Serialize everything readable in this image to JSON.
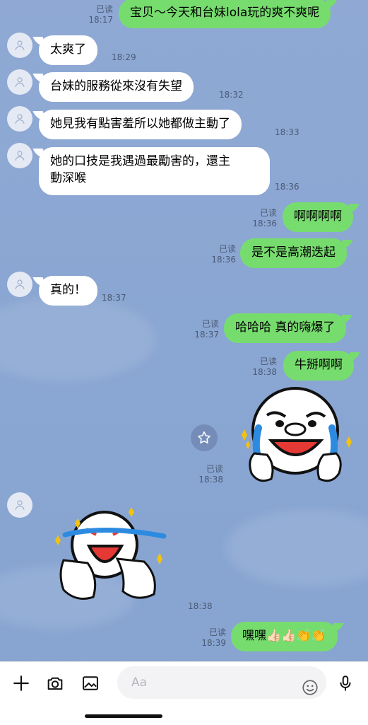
{
  "messages": [
    {
      "id": "m1",
      "side": "out",
      "text": "宝贝～今天和台妹lola玩的爽不爽呢",
      "read": "已读",
      "time": "18:17"
    },
    {
      "id": "m2",
      "side": "in",
      "text": "太爽了",
      "time": "18:29"
    },
    {
      "id": "m3",
      "side": "in",
      "text": "台妹的服務從來沒有失望",
      "time": "18:32"
    },
    {
      "id": "m4",
      "side": "in",
      "text": "她見我有點害羞所以她都做主動了",
      "time": "18:33"
    },
    {
      "id": "m5",
      "side": "in",
      "text_line1": "她的口技是我遇過最勵害的，還主",
      "text_line2": "動深喉",
      "time": "18:36"
    },
    {
      "id": "m6",
      "side": "out",
      "text": "啊啊啊啊",
      "read": "已读",
      "time": "18:36"
    },
    {
      "id": "m7",
      "side": "out",
      "text": "是不是高潮迭起",
      "read": "已读",
      "time": "18:36"
    },
    {
      "id": "m8",
      "side": "in",
      "text": "真的！",
      "time": "18:37"
    },
    {
      "id": "m9",
      "side": "out",
      "text": "哈哈哈 真的嗨爆了",
      "read": "已读",
      "time": "18:37"
    },
    {
      "id": "m10",
      "side": "out",
      "text": "牛掰啊啊",
      "read": "已读",
      "time": "18:38"
    },
    {
      "id": "m11",
      "side": "out",
      "sticker": "crying-laughing-face-sticker",
      "read": "已读",
      "time": "18:38"
    },
    {
      "id": "m12",
      "side": "in",
      "sticker": "laughing-thumbs-up-sticker",
      "time": "18:38"
    },
    {
      "id": "m13",
      "side": "out",
      "text": "嘿嘿👍🏻👍🏻👏👏",
      "read": "已读",
      "time": "18:39"
    }
  ],
  "composer": {
    "placeholder": "Aa",
    "icons": [
      "plus-icon",
      "camera-icon",
      "image-icon",
      "emoji-icon",
      "microphone-icon"
    ]
  },
  "colors": {
    "out_bubble": "#77dc6e",
    "in_bubble": "#ffffff",
    "background": "#8aa6d2"
  }
}
